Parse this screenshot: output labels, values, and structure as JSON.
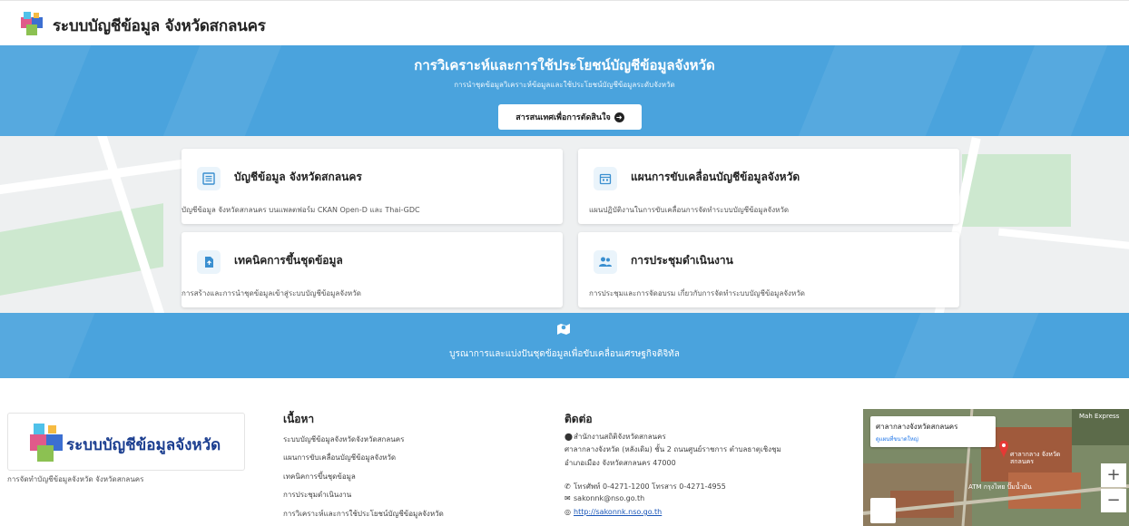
{
  "header": {
    "site_title": "ระบบบัญชีข้อมูล จังหวัดสกลนคร"
  },
  "hero": {
    "title": "การวิเคราะห์และการใช้ประโยชน์บัญชีข้อมูลจังหวัด",
    "subtitle": "การนำชุดข้อมูลวิเคราะห์ข้อมูลและใช้ประโยชน์บัญชีข้อมูลระดับจังหวัด",
    "button_label": "สารสนเทศเพื่อการตัดสินใจ"
  },
  "cards": [
    {
      "title": "บัญชีข้อมูล จังหวัดสกลนคร",
      "desc": "บัญชีข้อมูล จังหวัดสกลนคร บนแพลตฟอร์ม CKAN Open-D และ Thai-GDC",
      "icon": "list-icon"
    },
    {
      "title": "แผนการขับเคลื่อนบัญชีข้อมูลจังหวัด",
      "desc": "แผนปฏิบัติงานในการขับเคลื่อนการจัดทำระบบบัญชีข้อมูลจังหวัด",
      "icon": "calendar-icon"
    },
    {
      "title": "เทคนิคการขึ้นชุดข้อมูล",
      "desc": "การสร้างและการนำชุดข้อมูลเข้าสู่ระบบบัญชีข้อมูลจังหวัด",
      "icon": "file-upload-icon"
    },
    {
      "title": "การประชุมดำเนินงาน",
      "desc": "การประชุมและการจัดอบรม เกี่ยวกับการจัดทำระบบบัญชีข้อมูลจังหวัด",
      "icon": "users-icon"
    }
  ],
  "banner": {
    "text": "บูรณาการและแบ่งปันชุดข้อมูลเพื่อขับเคลื่อนเศรษฐกิจดิจิทัล"
  },
  "footer": {
    "logo_text": "ระบบบัญชีข้อมูลจังหวัด",
    "tagline": "การจัดทำบัญชีข้อมูลจังหวัด จังหวัดสกลนคร",
    "content_title": "เนื้อหา",
    "links": [
      "ระบบบัญชีข้อมูลจังหวัดจังหวัดสกลนคร",
      "แผนการขับเคลื่อนบัญชีข้อมูลจังหวัด",
      "เทคนิคการขึ้นชุดข้อมูล",
      "การประชุมดำเนินงาน",
      "การวิเคราะห์และการใช้ประโยชน์บัญชีข้อมูลจังหวัด"
    ],
    "contact_title": "ติดต่อ",
    "address1": "สำนักงานสถิติจังหวัดสกลนคร",
    "address2": "ศาลากลางจังหวัด (หลังเดิม) ชั้น 2 ถนนศูนย์ราชการ ตำบลธาตุเชิงชุม",
    "address3": "อำเภอเมือง จังหวัดสกลนคร 47000",
    "phone": "โทรศัพท์ 0-4271-1200 โทรสาร 0-4271-4955",
    "email": "sakonnk@nso.go.th",
    "website": "http://sakonnk.nso.go.th"
  },
  "map": {
    "place_name": "ศาลากลางจังหวัดสกลนคร",
    "place_link": "ดูแผนที่ขนาดใหญ่",
    "zoom_in": "+",
    "zoom_out": "−",
    "label_express": "Mah Express",
    "label_atm": "ATM กรุงไทย ปั๊มน้ำมัน",
    "label_hall": "ศาลากลาง จังหวัดสกลนคร"
  },
  "colors": {
    "accent_blue": "#4aa3dd",
    "logo_text_blue": "#1a3d8f"
  }
}
